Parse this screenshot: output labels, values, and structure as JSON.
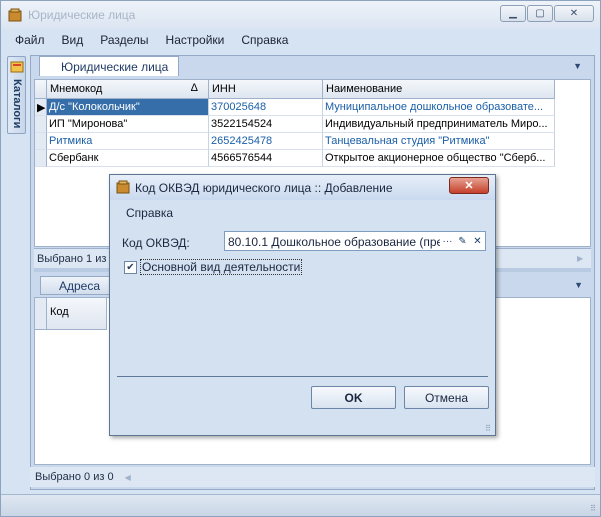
{
  "window": {
    "title": "Юридические лица"
  },
  "menu": [
    "Файл",
    "Вид",
    "Разделы",
    "Настройки",
    "Справка"
  ],
  "side_panel": {
    "label": "Каталоги"
  },
  "doc_tab": {
    "label": "Юридические лица"
  },
  "grid": {
    "columns": [
      "Мнемокод",
      "ИНН",
      "Наименование"
    ],
    "rows": [
      {
        "mnemo": "Д/с \"Колокольчик\"",
        "inn": "370025648",
        "name": "Муниципальное дошкольное образовате..."
      },
      {
        "mnemo": "ИП \"Миронова\"",
        "inn": "3522154524",
        "name": "Индивидуальный предприниматель Миро..."
      },
      {
        "mnemo": "Ритмика",
        "inn": "2652425478",
        "name": "Танцевальная студия \"Ритмика\""
      },
      {
        "mnemo": "Сбербанк",
        "inn": "4566576544",
        "name": "Открытое акционерное общество \"Сберб..."
      }
    ],
    "status": "Выбрано 1 из"
  },
  "lower": {
    "tab": "Адреса",
    "column": "Код",
    "status": "Выбрано 0 из 0"
  },
  "dialog": {
    "title": "Код ОКВЭД юридического лица :: Добавление",
    "menu": "Справка",
    "field_label": "Код ОКВЭД:",
    "field_value": "80.10.1 Дошкольное образование (пре...",
    "checkbox_label": "Основной вид деятельности",
    "checkbox_checked": true,
    "ok": "OK",
    "cancel": "Отмена"
  },
  "colors": {
    "selection": "#356ea8",
    "accent_text": "#1a5fa8",
    "close_button": "#c4402b"
  }
}
